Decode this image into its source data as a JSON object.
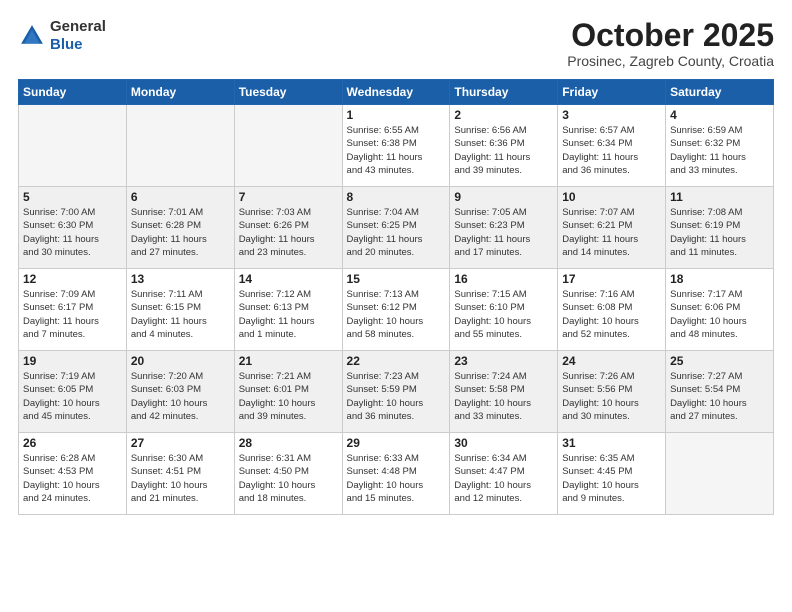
{
  "logo": {
    "general": "General",
    "blue": "Blue"
  },
  "header": {
    "month": "October 2025",
    "location": "Prosinec, Zagreb County, Croatia"
  },
  "weekdays": [
    "Sunday",
    "Monday",
    "Tuesday",
    "Wednesday",
    "Thursday",
    "Friday",
    "Saturday"
  ],
  "weeks": [
    [
      {
        "day": "",
        "info": ""
      },
      {
        "day": "",
        "info": ""
      },
      {
        "day": "",
        "info": ""
      },
      {
        "day": "1",
        "info": "Sunrise: 6:55 AM\nSunset: 6:38 PM\nDaylight: 11 hours\nand 43 minutes."
      },
      {
        "day": "2",
        "info": "Sunrise: 6:56 AM\nSunset: 6:36 PM\nDaylight: 11 hours\nand 39 minutes."
      },
      {
        "day": "3",
        "info": "Sunrise: 6:57 AM\nSunset: 6:34 PM\nDaylight: 11 hours\nand 36 minutes."
      },
      {
        "day": "4",
        "info": "Sunrise: 6:59 AM\nSunset: 6:32 PM\nDaylight: 11 hours\nand 33 minutes."
      }
    ],
    [
      {
        "day": "5",
        "info": "Sunrise: 7:00 AM\nSunset: 6:30 PM\nDaylight: 11 hours\nand 30 minutes."
      },
      {
        "day": "6",
        "info": "Sunrise: 7:01 AM\nSunset: 6:28 PM\nDaylight: 11 hours\nand 27 minutes."
      },
      {
        "day": "7",
        "info": "Sunrise: 7:03 AM\nSunset: 6:26 PM\nDaylight: 11 hours\nand 23 minutes."
      },
      {
        "day": "8",
        "info": "Sunrise: 7:04 AM\nSunset: 6:25 PM\nDaylight: 11 hours\nand 20 minutes."
      },
      {
        "day": "9",
        "info": "Sunrise: 7:05 AM\nSunset: 6:23 PM\nDaylight: 11 hours\nand 17 minutes."
      },
      {
        "day": "10",
        "info": "Sunrise: 7:07 AM\nSunset: 6:21 PM\nDaylight: 11 hours\nand 14 minutes."
      },
      {
        "day": "11",
        "info": "Sunrise: 7:08 AM\nSunset: 6:19 PM\nDaylight: 11 hours\nand 11 minutes."
      }
    ],
    [
      {
        "day": "12",
        "info": "Sunrise: 7:09 AM\nSunset: 6:17 PM\nDaylight: 11 hours\nand 7 minutes."
      },
      {
        "day": "13",
        "info": "Sunrise: 7:11 AM\nSunset: 6:15 PM\nDaylight: 11 hours\nand 4 minutes."
      },
      {
        "day": "14",
        "info": "Sunrise: 7:12 AM\nSunset: 6:13 PM\nDaylight: 11 hours\nand 1 minute."
      },
      {
        "day": "15",
        "info": "Sunrise: 7:13 AM\nSunset: 6:12 PM\nDaylight: 10 hours\nand 58 minutes."
      },
      {
        "day": "16",
        "info": "Sunrise: 7:15 AM\nSunset: 6:10 PM\nDaylight: 10 hours\nand 55 minutes."
      },
      {
        "day": "17",
        "info": "Sunrise: 7:16 AM\nSunset: 6:08 PM\nDaylight: 10 hours\nand 52 minutes."
      },
      {
        "day": "18",
        "info": "Sunrise: 7:17 AM\nSunset: 6:06 PM\nDaylight: 10 hours\nand 48 minutes."
      }
    ],
    [
      {
        "day": "19",
        "info": "Sunrise: 7:19 AM\nSunset: 6:05 PM\nDaylight: 10 hours\nand 45 minutes."
      },
      {
        "day": "20",
        "info": "Sunrise: 7:20 AM\nSunset: 6:03 PM\nDaylight: 10 hours\nand 42 minutes."
      },
      {
        "day": "21",
        "info": "Sunrise: 7:21 AM\nSunset: 6:01 PM\nDaylight: 10 hours\nand 39 minutes."
      },
      {
        "day": "22",
        "info": "Sunrise: 7:23 AM\nSunset: 5:59 PM\nDaylight: 10 hours\nand 36 minutes."
      },
      {
        "day": "23",
        "info": "Sunrise: 7:24 AM\nSunset: 5:58 PM\nDaylight: 10 hours\nand 33 minutes."
      },
      {
        "day": "24",
        "info": "Sunrise: 7:26 AM\nSunset: 5:56 PM\nDaylight: 10 hours\nand 30 minutes."
      },
      {
        "day": "25",
        "info": "Sunrise: 7:27 AM\nSunset: 5:54 PM\nDaylight: 10 hours\nand 27 minutes."
      }
    ],
    [
      {
        "day": "26",
        "info": "Sunrise: 6:28 AM\nSunset: 4:53 PM\nDaylight: 10 hours\nand 24 minutes."
      },
      {
        "day": "27",
        "info": "Sunrise: 6:30 AM\nSunset: 4:51 PM\nDaylight: 10 hours\nand 21 minutes."
      },
      {
        "day": "28",
        "info": "Sunrise: 6:31 AM\nSunset: 4:50 PM\nDaylight: 10 hours\nand 18 minutes."
      },
      {
        "day": "29",
        "info": "Sunrise: 6:33 AM\nSunset: 4:48 PM\nDaylight: 10 hours\nand 15 minutes."
      },
      {
        "day": "30",
        "info": "Sunrise: 6:34 AM\nSunset: 4:47 PM\nDaylight: 10 hours\nand 12 minutes."
      },
      {
        "day": "31",
        "info": "Sunrise: 6:35 AM\nSunset: 4:45 PM\nDaylight: 10 hours\nand 9 minutes."
      },
      {
        "day": "",
        "info": ""
      }
    ]
  ]
}
